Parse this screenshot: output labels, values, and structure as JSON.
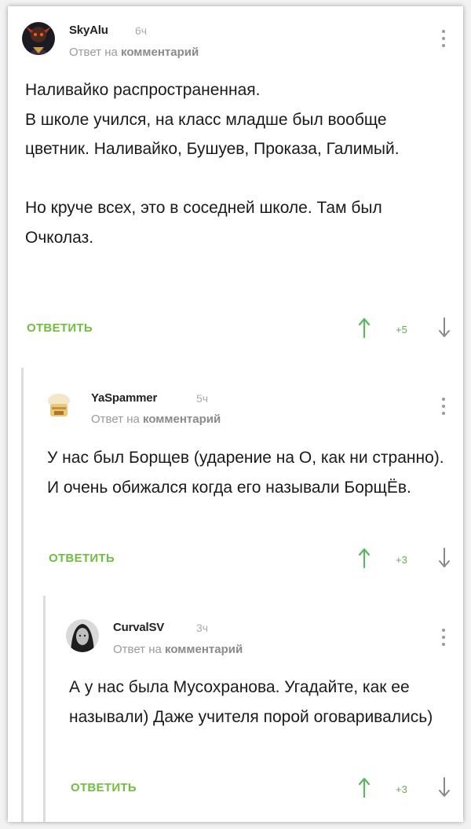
{
  "comments": [
    {
      "username": "SkyAlu",
      "time": "6ч",
      "reply_prefix": "Ответ на",
      "reply_target": "комментарий",
      "text": "Наливайко распространенная.\nВ школе учился, на класс младше был вообще цветник. Наливайко, Бушуев, Проказа, Галимый.\n\nНо круче всех, это в соседней школе. Там был Очколаз.",
      "reply_label": "ОТВЕТИТЬ",
      "score": "+5",
      "colors": {
        "upvote": "#5cb85c",
        "downvote": "#888888"
      }
    },
    {
      "username": "YaSpammer",
      "time": "5ч",
      "reply_prefix": "Ответ на",
      "reply_target": "комментарий",
      "text": "У нас был Борщев (ударение на О, как ни странно). И очень обижался когда его называли БорщЁв.",
      "reply_label": "ОТВЕТИТЬ",
      "score": "+3"
    },
    {
      "username": "CurvalSV",
      "time": "3ч",
      "reply_prefix": "Ответ на",
      "reply_target": "комментарий",
      "text": "А у нас была Мусохранова. Угадайте, как ее называли) Даже учителя порой оговаривались)",
      "reply_label": "ОТВЕТИТЬ",
      "score": "+3"
    }
  ],
  "colors": {
    "accent_green": "#6fbf3f",
    "thread_line": "#dcdcdc"
  }
}
